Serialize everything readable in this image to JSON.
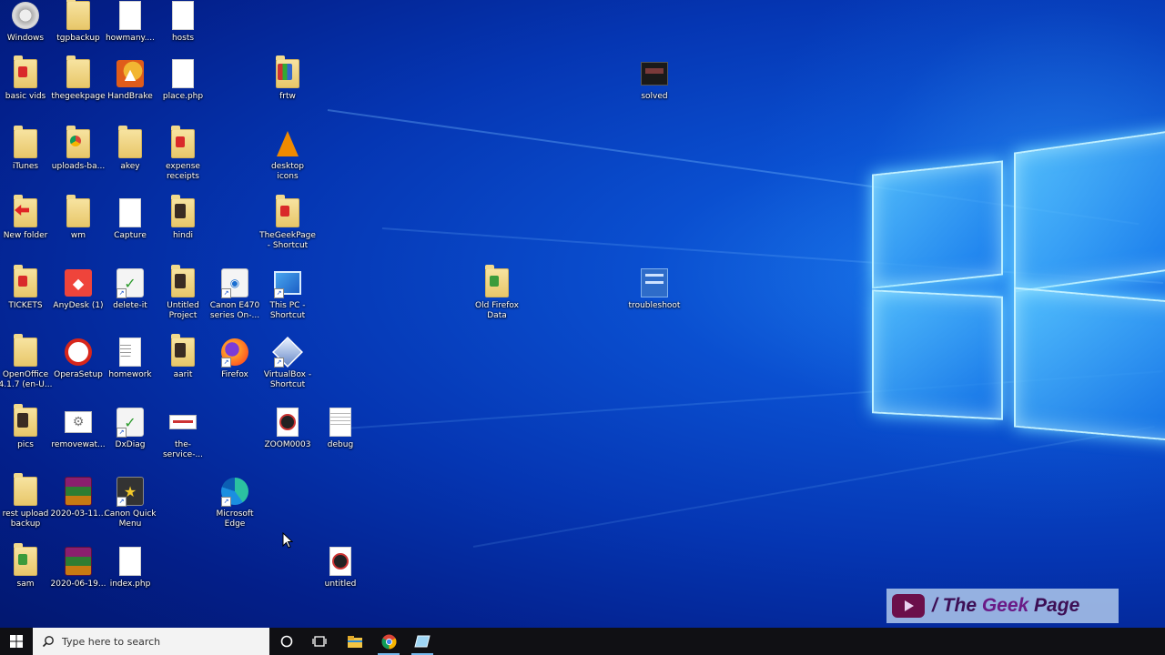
{
  "desktop": {
    "icons": [
      {
        "label": "Windows",
        "type": "app-disc"
      },
      {
        "label": "tgpbackup",
        "type": "folder"
      },
      {
        "label": "howmany....",
        "type": "doc"
      },
      {
        "label": "hosts",
        "type": "doc"
      },
      {
        "label": "basic vids",
        "type": "folder-red"
      },
      {
        "label": "thegeekpage",
        "type": "folder"
      },
      {
        "label": "HandBrake",
        "type": "handbrake"
      },
      {
        "label": "place.php",
        "type": "doc"
      },
      {
        "label": "frtw",
        "type": "folder-multi"
      },
      {
        "label": "solved",
        "type": "image-dark"
      },
      {
        "label": "iTunes",
        "type": "folder"
      },
      {
        "label": "uploads-ba...",
        "type": "folder-chrome"
      },
      {
        "label": "akey",
        "type": "folder"
      },
      {
        "label": "expense receipts",
        "type": "folder-red"
      },
      {
        "label": "desktop icons",
        "type": "vlc"
      },
      {
        "label": "New folder",
        "type": "folder-arrow"
      },
      {
        "label": "wm",
        "type": "folder"
      },
      {
        "label": "Capture",
        "type": "doc"
      },
      {
        "label": "hindi",
        "type": "folder-dark"
      },
      {
        "label": "TheGeekPage - Shortcut",
        "type": "folder-red"
      },
      {
        "label": "TICKETS",
        "type": "folder-red"
      },
      {
        "label": "AnyDesk (1)",
        "type": "anydesk"
      },
      {
        "label": "delete-it",
        "type": "dxdiag"
      },
      {
        "label": "Untitled Project",
        "type": "folder-dark"
      },
      {
        "label": "Canon E470 series On-...",
        "type": "canon"
      },
      {
        "label": "This PC - Shortcut",
        "type": "thispc"
      },
      {
        "label": "Old Firefox Data",
        "type": "folder-green"
      },
      {
        "label": "troubleshoot",
        "type": "image-blue"
      },
      {
        "label": "OpenOffice 4.1.7 (en-U...",
        "type": "folder"
      },
      {
        "label": "OperaSetup",
        "type": "opera"
      },
      {
        "label": "homework",
        "type": "doc-grid"
      },
      {
        "label": "aarit",
        "type": "folder-dark"
      },
      {
        "label": "Firefox",
        "type": "firefox"
      },
      {
        "label": "VirtualBox - Shortcut",
        "type": "virtualbox"
      },
      {
        "label": "pics",
        "type": "folder-dark"
      },
      {
        "label": "removewat...",
        "type": "gear-doc"
      },
      {
        "label": "DxDiag",
        "type": "dxdiag"
      },
      {
        "label": "the-service-...",
        "type": "image-wide"
      },
      {
        "label": "ZOOM0003",
        "type": "media"
      },
      {
        "label": "debug",
        "type": "text"
      },
      {
        "label": "rest upload backup",
        "type": "folder"
      },
      {
        "label": "2020-03-11...",
        "type": "winrar"
      },
      {
        "label": "Canon Quick Menu",
        "type": "canonqm"
      },
      {
        "label": "Microsoft Edge",
        "type": "edge"
      },
      {
        "label": "sam",
        "type": "folder-green"
      },
      {
        "label": "2020-06-19...",
        "type": "winrar"
      },
      {
        "label": "index.php",
        "type": "doc"
      },
      {
        "label": "untitled",
        "type": "media"
      }
    ]
  },
  "taskbar": {
    "search_placeholder": "Type here to search",
    "buttons": [
      "start-icon",
      "cortana-icon",
      "task-view-icon",
      "file-explorer-icon",
      "chrome-icon",
      "notepad-icon"
    ]
  },
  "watermark": {
    "prefix": "/ The ",
    "brand_main": "Geek",
    "brand_tail": " Page"
  },
  "colors": {
    "desktop_bg": "#0a4fd0",
    "taskbar_bg": "#101014",
    "watermark_bg": "#afc8eb",
    "watermark_text": "#3d0f55"
  }
}
